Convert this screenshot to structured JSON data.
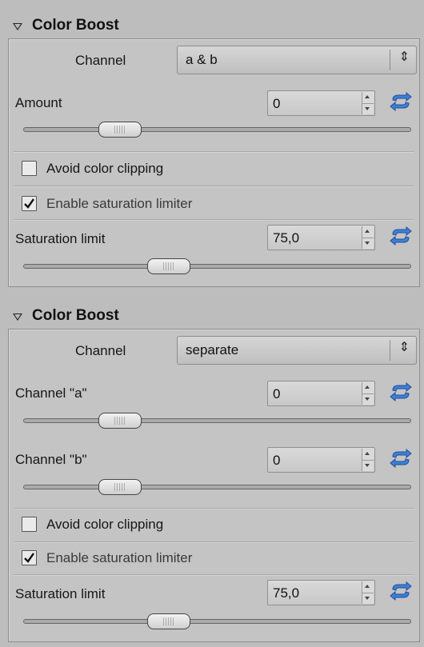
{
  "sections": [
    {
      "title": "Color Boost",
      "channel_label": "Channel",
      "channel_value": "a & b",
      "params": [
        {
          "label": "Amount",
          "value": "0",
          "slider_fraction": 0.25
        }
      ],
      "avoid_clipping": {
        "label": "Avoid color clipping",
        "checked": false
      },
      "saturation_limiter": {
        "label": "Enable saturation limiter",
        "checked": true
      },
      "saturation_limit": {
        "label": "Saturation limit",
        "value": "75,0",
        "slider_fraction": 0.375
      }
    },
    {
      "title": "Color Boost",
      "channel_label": "Channel",
      "channel_value": "separate",
      "params": [
        {
          "label": "Channel \"a\"",
          "value": "0",
          "slider_fraction": 0.25
        },
        {
          "label": "Channel \"b\"",
          "value": "0",
          "slider_fraction": 0.25
        }
      ],
      "avoid_clipping": {
        "label": "Avoid color clipping",
        "checked": false
      },
      "saturation_limiter": {
        "label": "Enable saturation limiter",
        "checked": true
      },
      "saturation_limit": {
        "label": "Saturation limit",
        "value": "75,0",
        "slider_fraction": 0.375
      }
    }
  ],
  "icons": {
    "reset": "reset-icon",
    "collapse": "collapse-triangle-icon",
    "dropdown_arrows": "updown-arrows-icon",
    "checkmark": "checkmark-icon"
  }
}
